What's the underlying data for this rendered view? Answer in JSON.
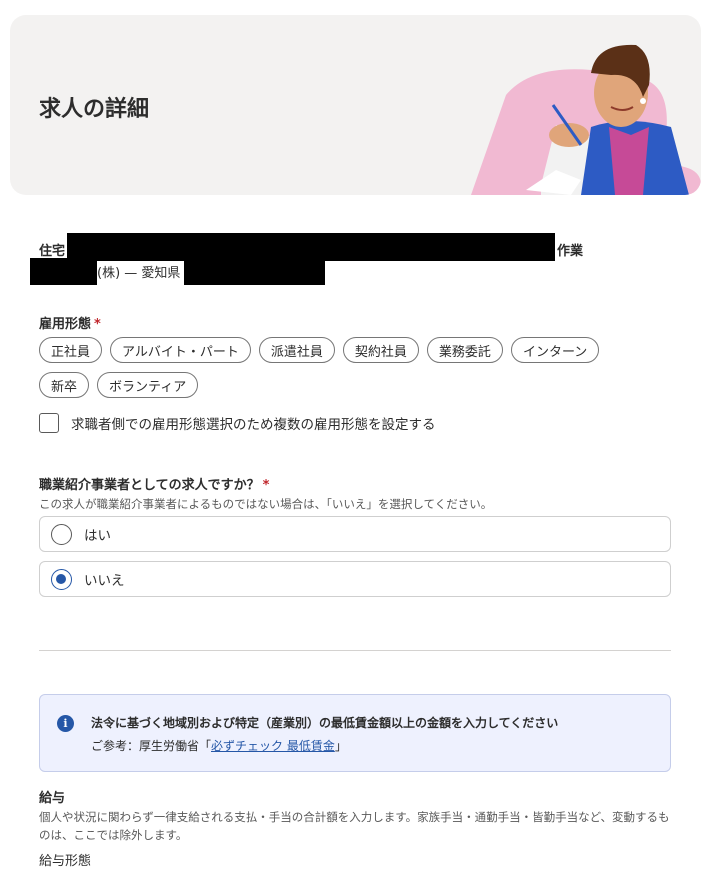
{
  "header": {
    "title": "求人の詳細"
  },
  "company": {
    "address_prefix": "住宅",
    "address_suffix": "作業",
    "company_suffix": "(株) — 愛知県"
  },
  "employment_type": {
    "label": "雇用形態",
    "required": "*",
    "options": [
      "正社員",
      "アルバイト・パート",
      "派遣社員",
      "契約社員",
      "業務委託",
      "インターン",
      "新卒",
      "ボランティア"
    ],
    "multi_select_label": "求職者側での雇用形態選択のため複数の雇用形態を設定する"
  },
  "agency_question": {
    "label": "職業紹介事業者としての求人ですか？",
    "required": "*",
    "helper": "この求人が職業紹介事業者によるものではない場合は、「いいえ」を選択してください。",
    "options": [
      "はい",
      "いいえ"
    ],
    "selected": "いいえ"
  },
  "wage_notice": {
    "icon": "info-icon",
    "title": "法令に基づく地域別および特定（産業別）の最低賃金額以上の金額を入力してください",
    "ref_prefix": "ご参考：厚生労働省「",
    "ref_link": "必ずチェック 最低賃金",
    "ref_suffix": "」"
  },
  "salary": {
    "label": "給与",
    "description": "個人や状況に関わらず一律支給される支払・手当の合計額を入力します。家族手当・通勤手当・皆勤手当など、変動するものは、ここでは除外します。",
    "type_label": "給与形態"
  },
  "colors": {
    "accent": "#2557a7",
    "required": "#c0262b",
    "header_bg": "#f3f2f1",
    "notice_bg": "#eef1fe"
  }
}
